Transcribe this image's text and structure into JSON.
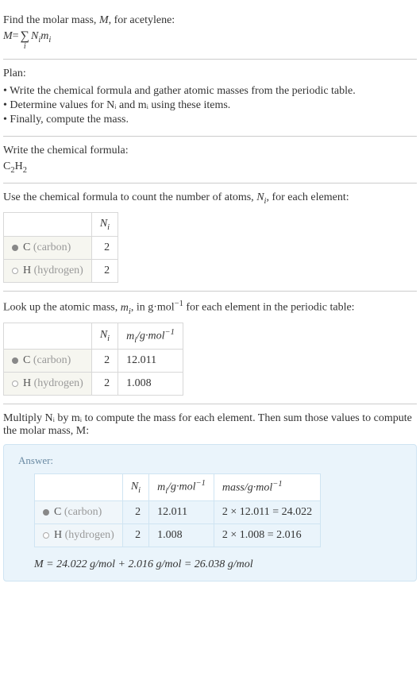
{
  "intro": {
    "line1": "Find the molar mass, ",
    "var_M": "M",
    "line1b": ", for acetylene:",
    "eq_lhs": "M",
    "eq_eq": " = ",
    "eq_term": "N",
    "eq_term2": "m"
  },
  "plan": {
    "heading": "Plan:",
    "items": [
      "• Write the chemical formula and gather atomic masses from the periodic table.",
      "• Determine values for Nᵢ and mᵢ using these items.",
      "• Finally, compute the mass."
    ]
  },
  "formula_section": {
    "heading": "Write the chemical formula:",
    "formula": "C",
    "sub1": "2",
    "formula2": "H",
    "sub2": "2"
  },
  "count_section": {
    "heading_a": "Use the chemical formula to count the number of atoms, ",
    "heading_var": "N",
    "heading_b": ", for each element:",
    "header_ni": "N",
    "rows": [
      {
        "sym": "C",
        "name": " (carbon)",
        "ni": "2",
        "filled": true
      },
      {
        "sym": "H",
        "name": " (hydrogen)",
        "ni": "2",
        "filled": false
      }
    ]
  },
  "mass_section": {
    "heading_a": "Look up the atomic mass, ",
    "heading_var": "m",
    "heading_b": ", in g·mol",
    "heading_exp": "−1",
    "heading_c": " for each element in the periodic table:",
    "header_ni": "N",
    "header_mi": "m",
    "header_unit": "/g·mol",
    "rows": [
      {
        "sym": "C",
        "name": " (carbon)",
        "ni": "2",
        "mi": "12.011",
        "filled": true
      },
      {
        "sym": "H",
        "name": " (hydrogen)",
        "ni": "2",
        "mi": "1.008",
        "filled": false
      }
    ]
  },
  "multiply_section": {
    "heading": "Multiply Nᵢ by mᵢ to compute the mass for each element. Then sum those values to compute the molar mass, M:"
  },
  "answer": {
    "label": "Answer:",
    "header_ni": "N",
    "header_mi": "m",
    "header_unit": "/g·mol",
    "header_mass": "mass/g·mol",
    "rows": [
      {
        "sym": "C",
        "name": " (carbon)",
        "ni": "2",
        "mi": "12.011",
        "mass": "2 × 12.011 = 24.022",
        "filled": true
      },
      {
        "sym": "H",
        "name": " (hydrogen)",
        "ni": "2",
        "mi": "1.008",
        "mass": "2 × 1.008 = 2.016",
        "filled": false
      }
    ],
    "final": "M = 24.022 g/mol + 2.016 g/mol = 26.038 g/mol"
  }
}
